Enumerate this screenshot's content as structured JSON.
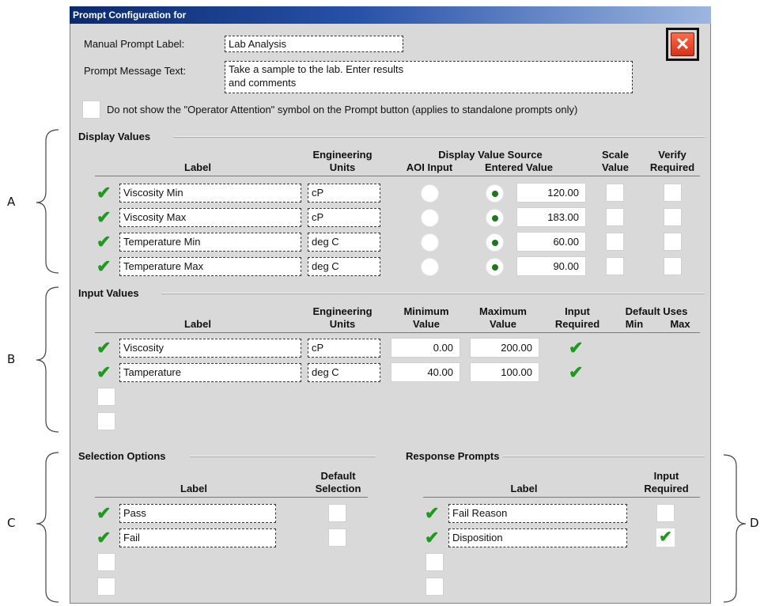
{
  "window": {
    "title": "Prompt Configuration for"
  },
  "manual_prompt_label": {
    "label": "Manual Prompt Label:",
    "value": "Lab Analysis"
  },
  "prompt_message_text": {
    "label": "Prompt Message Text:",
    "line1": "Take a sample to the lab. Enter results",
    "line2": "and comments"
  },
  "operator_attention_text": "Do not show the \"Operator Attention\" symbol on the Prompt button (applies to standalone prompts only)",
  "display_values": {
    "title": "Display Values",
    "headers": {
      "label": "Label",
      "eng_units_1": "Engineering",
      "eng_units_2": "Units",
      "source": "Display Value Source",
      "aoi_input": "AOI Input",
      "entered_value": "Entered Value",
      "scale_1": "Scale",
      "scale_2": "Value",
      "verify_1": "Verify",
      "verify_2": "Required"
    },
    "rows": [
      {
        "label": "Viscosity Min",
        "units": "cP",
        "value": "120.00"
      },
      {
        "label": "Viscosity Max",
        "units": "cP",
        "value": "183.00"
      },
      {
        "label": "Temperature Min",
        "units": "deg C",
        "value": "60.00"
      },
      {
        "label": "Temperature Max",
        "units": "deg C",
        "value": "90.00"
      }
    ]
  },
  "input_values": {
    "title": "Input Values",
    "headers": {
      "label": "Label",
      "eng_units_1": "Engineering",
      "eng_units_2": "Units",
      "min_1": "Minimum",
      "min_2": "Value",
      "max_1": "Maximum",
      "max_2": "Value",
      "req_1": "Input",
      "req_2": "Required",
      "default_uses": "Default Uses",
      "def_min": "Min",
      "def_max": "Max"
    },
    "rows": [
      {
        "label": "Viscosity",
        "units": "cP",
        "min": "0.00",
        "max": "200.00"
      },
      {
        "label": "Tamperature",
        "units": "deg C",
        "min": "40.00",
        "max": "100.00"
      }
    ]
  },
  "selection_options": {
    "title": "Selection Options",
    "headers": {
      "label": "Label",
      "default_1": "Default",
      "default_2": "Selection"
    },
    "rows": [
      {
        "label": "Pass"
      },
      {
        "label": "Fail"
      }
    ]
  },
  "response_prompts": {
    "title": "Response Prompts",
    "headers": {
      "label": "Label",
      "req_1": "Input",
      "req_2": "Required"
    },
    "rows": [
      {
        "label": "Fail Reason"
      },
      {
        "label": "Disposition"
      }
    ]
  },
  "side_labels": {
    "a": "A",
    "b": "B",
    "c": "C",
    "d": "D"
  },
  "icons": {
    "check": "check-icon",
    "close": "close-icon"
  },
  "colors": {
    "check_green": "#1f9a1f",
    "close_red": "#e04a2a",
    "titlebar": "#0b2a6e"
  },
  "glyphs": {
    "check": "✔",
    "close": "✕"
  }
}
